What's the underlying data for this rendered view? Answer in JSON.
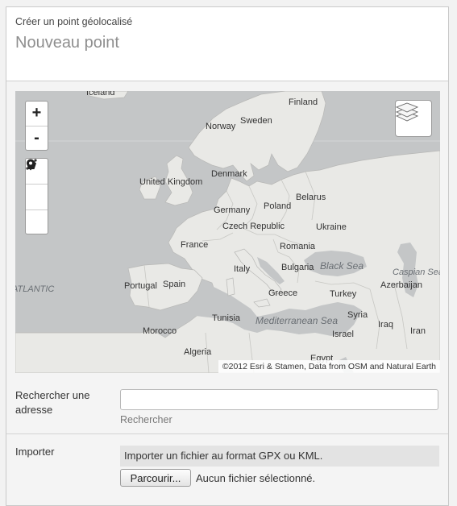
{
  "header": {
    "subtitle": "Créer un point géolocalisé",
    "title": "Nouveau point"
  },
  "map": {
    "zoom_in": "+",
    "zoom_out": "-",
    "attribution": "©2012 Esri & Stamen, Data from OSM and Natural Earth",
    "countries": [
      "Iceland",
      "Finland",
      "Norway",
      "Sweden",
      "Denmark",
      "United Kingdom",
      "Belarus",
      "Poland",
      "Germany",
      "Czech Republic",
      "Ukraine",
      "France",
      "Romania",
      "Bulgaria",
      "Italy",
      "Portugal",
      "Spain",
      "Greece",
      "Turkey",
      "Azerbaijan",
      "Syria",
      "Tunisia",
      "Iraq",
      "Morocco",
      "Israel",
      "Iran",
      "Algeria",
      "Egypt"
    ],
    "seas": [
      "Black Sea",
      "Mediterranean Sea",
      "Caspian Sea",
      "ATLANTIC"
    ]
  },
  "form": {
    "search_label": "Rechercher une adresse",
    "search_value": "",
    "search_action": "Rechercher",
    "import_label": "Importer",
    "import_info": "Importer un fichier au format GPX ou KML.",
    "browse_button": "Parcourir...",
    "no_file": "Aucun fichier sélectionné."
  }
}
